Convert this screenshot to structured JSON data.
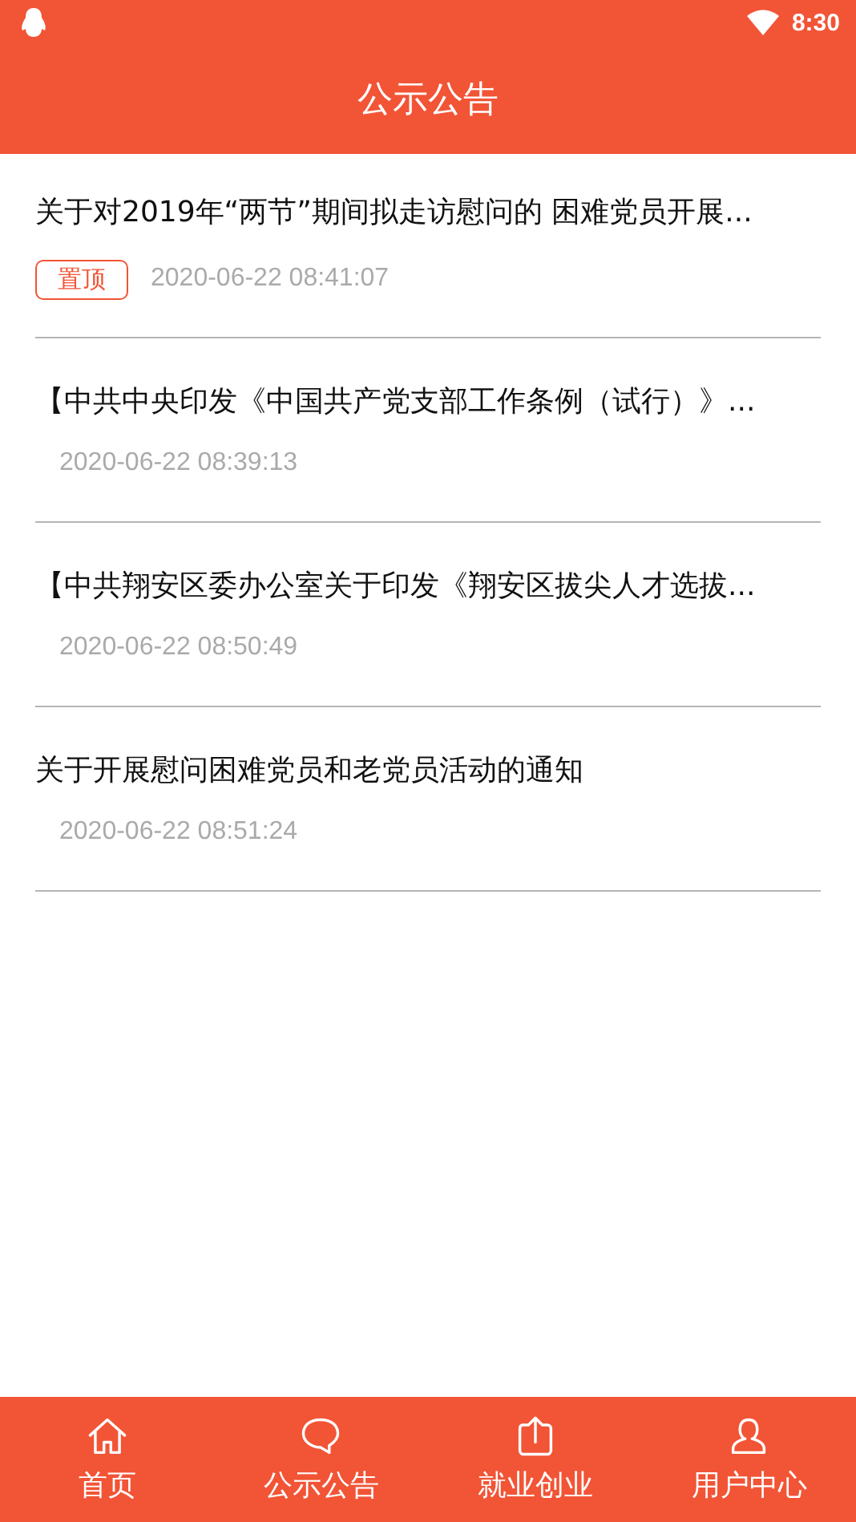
{
  "status_bar": {
    "time": "8:30"
  },
  "header": {
    "title": "公示公告"
  },
  "notices": [
    {
      "title": "关于对2019年“两节”期间拟走访慰问的 困难党员开展...",
      "pinned": true,
      "badge": "置顶",
      "date": "2020-06-22 08:41:07"
    },
    {
      "title": "【中共中央印发《中国共产党支部工作条例（试行）》...",
      "pinned": false,
      "date": "2020-06-22 08:39:13"
    },
    {
      "title": "【中共翔安区委办公室关于印发《翔安区拔尖人才选拔...",
      "pinned": false,
      "date": "2020-06-22 08:50:49"
    },
    {
      "title": "关于开展慰问困难党员和老党员活动的通知",
      "pinned": false,
      "date": "2020-06-22 08:51:24"
    }
  ],
  "bottom_nav": [
    {
      "label": "首页"
    },
    {
      "label": "公示公告"
    },
    {
      "label": "就业创业"
    },
    {
      "label": "用户中心"
    }
  ]
}
